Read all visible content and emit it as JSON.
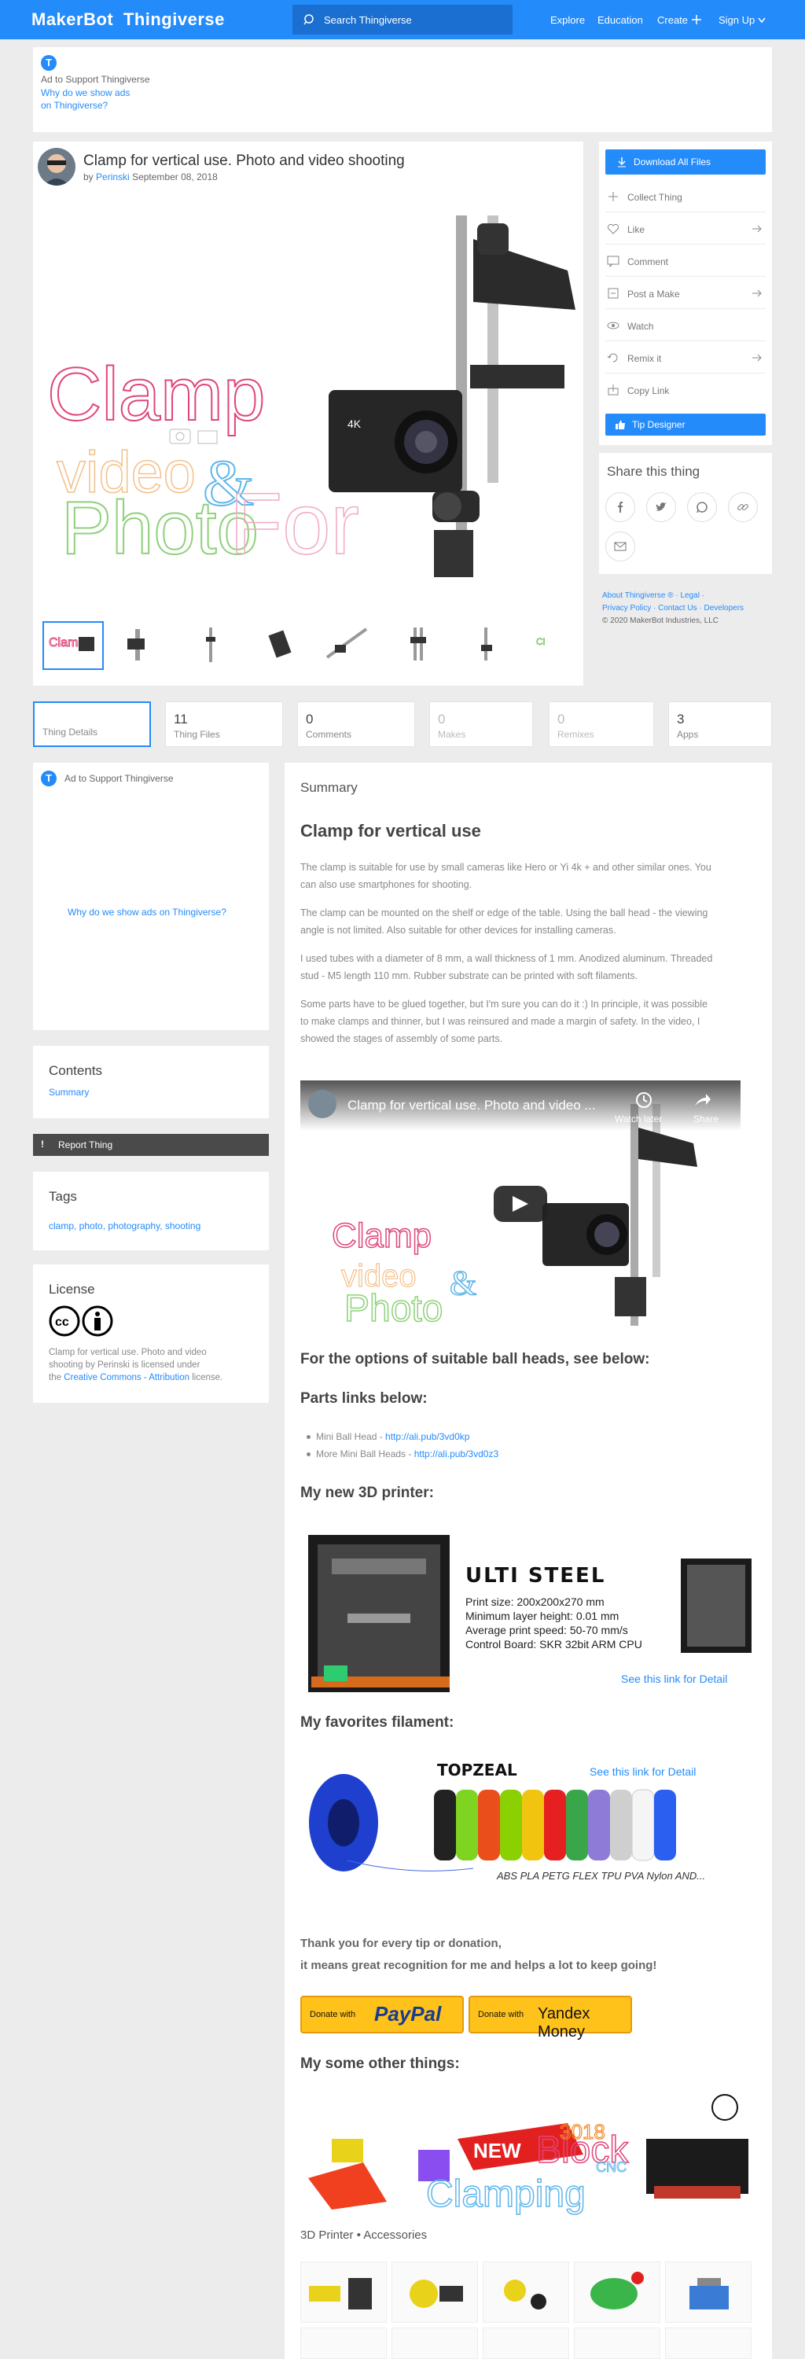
{
  "header": {
    "logo_maker": "MakerBot",
    "logo_thing": "Thingiverse",
    "search_placeholder": "Search Thingiverse",
    "nav": [
      "Explore",
      "Education",
      "Create",
      "Sign Up"
    ]
  },
  "ad_top": {
    "badge": "T",
    "label": "Ad to Support Thingiverse",
    "why_line1": "Why do we show ads",
    "why_line2": "on Thingiverse?"
  },
  "thing": {
    "title": "Clamp for vertical use. Photo and video shooting",
    "by": "by",
    "author": "Perinski",
    "date": "September 08, 2018",
    "hero_text": [
      "Clamp",
      "video",
      "Photo",
      "&",
      "For"
    ],
    "camera_label": "4K"
  },
  "actions": {
    "download": "Download All Files",
    "items": [
      "Collect Thing",
      "Like",
      "Comment",
      "Post a Make",
      "Watch",
      "Remix it",
      "Copy Link"
    ],
    "tip": "Tip Designer"
  },
  "share": {
    "title": "Share this thing"
  },
  "footer": {
    "line1": "About Thingiverse ® · Legal ·",
    "line2": "Privacy Policy · Contact Us · Developers",
    "copyright": "© 2020 MakerBot Industries, LLC"
  },
  "stats": [
    {
      "num": "",
      "label": "Thing Details"
    },
    {
      "num": "11",
      "label": "Thing Files"
    },
    {
      "num": "0",
      "label": "Comments"
    },
    {
      "num": "0",
      "label": "Makes"
    },
    {
      "num": "0",
      "label": "Remixes"
    },
    {
      "num": "3",
      "label": "Apps"
    }
  ],
  "left": {
    "ad_label": "Ad to Support Thingiverse",
    "ad_why": "Why do we show ads on Thingiverse?",
    "contents_title": "Contents",
    "contents_item": "Summary",
    "report": "Report Thing",
    "tags_title": "Tags",
    "tags": "clamp, photo, photography, shooting",
    "license_title": "License",
    "license_text1": "Clamp for vertical use. Photo and video",
    "license_text2": "shooting by Perinski is licensed under",
    "license_text3": "the",
    "license_link": "Creative Commons - Attribution",
    "license_text4": "license."
  },
  "summary": {
    "label": "Summary",
    "heading": "Clamp for vertical use",
    "p1a": "The clamp is suitable for use by small cameras like Hero or Yi 4k + and other similar ones. You",
    "p1b": "can also use smartphones for shooting.",
    "p2a": "The clamp can be mounted on the shelf or edge of the table. Using the ball head - the viewing",
    "p2b": "angle is not limited. Also suitable for other devices for installing cameras.",
    "p3a": "I used tubes with a diameter of 8 mm, a wall thickness of 1 mm. Anodized aluminum. Threaded",
    "p3b": "stud - M5 length 110 mm. Rubber substrate can be printed with soft filaments.",
    "p4a": "Some parts have to be glued together, but I'm sure you can do it :) In principle, it was possible",
    "p4b": "to make clamps and thinner, but I was reinsured and made a margin of safety. In the video, I",
    "p4c": "showed the stages of assembly of some parts.",
    "video_title": "Clamp for vertical use. Photo and video ...",
    "watch_later": "Watch later",
    "share": "Share",
    "options_heading": "For the options of suitable ball heads, see below:",
    "parts_heading": "Parts links below:",
    "part1_label": "Mini Ball Head -",
    "part1_link": "http://ali.pub/3vd0kp",
    "part2_label": "More Mini Ball Heads -",
    "part2_link": "http://ali.pub/3vd0z3",
    "printer_heading": "My new 3D printer:",
    "printer_name": "ULTI STEEL",
    "printer_specs": [
      "Print size: 200x200x270 mm",
      "Minimum layer height: 0.01 mm",
      "Average print speed: 50-70 mm/s",
      "Control Board: SKR 32bit ARM CPU"
    ],
    "printer_link": "See this link for Detail",
    "filament_heading": "My favorites filament:",
    "filament_brand": "TOPZEAL",
    "filament_link": "See this link for Detail",
    "filament_types": "ABS PLA PETG FLEX TPU PVA Nylon AND...",
    "thanks1": "Thank you for every tip or donation,",
    "thanks2": "it means great recognition for me and helps a lot to keep going!",
    "donate_with": "Donate with",
    "paypal": "PayPal",
    "yandex": "Yandex Money",
    "other_heading": "My some other things:",
    "other_banner": [
      "NEW",
      "Block",
      "Clamping",
      "3018",
      "CNC"
    ],
    "category": "3D Printer • Accessories"
  },
  "colors": {
    "accent": "#248bfb",
    "pink": "#e0457b",
    "green": "#8ed17a",
    "orange": "#f08a24"
  }
}
